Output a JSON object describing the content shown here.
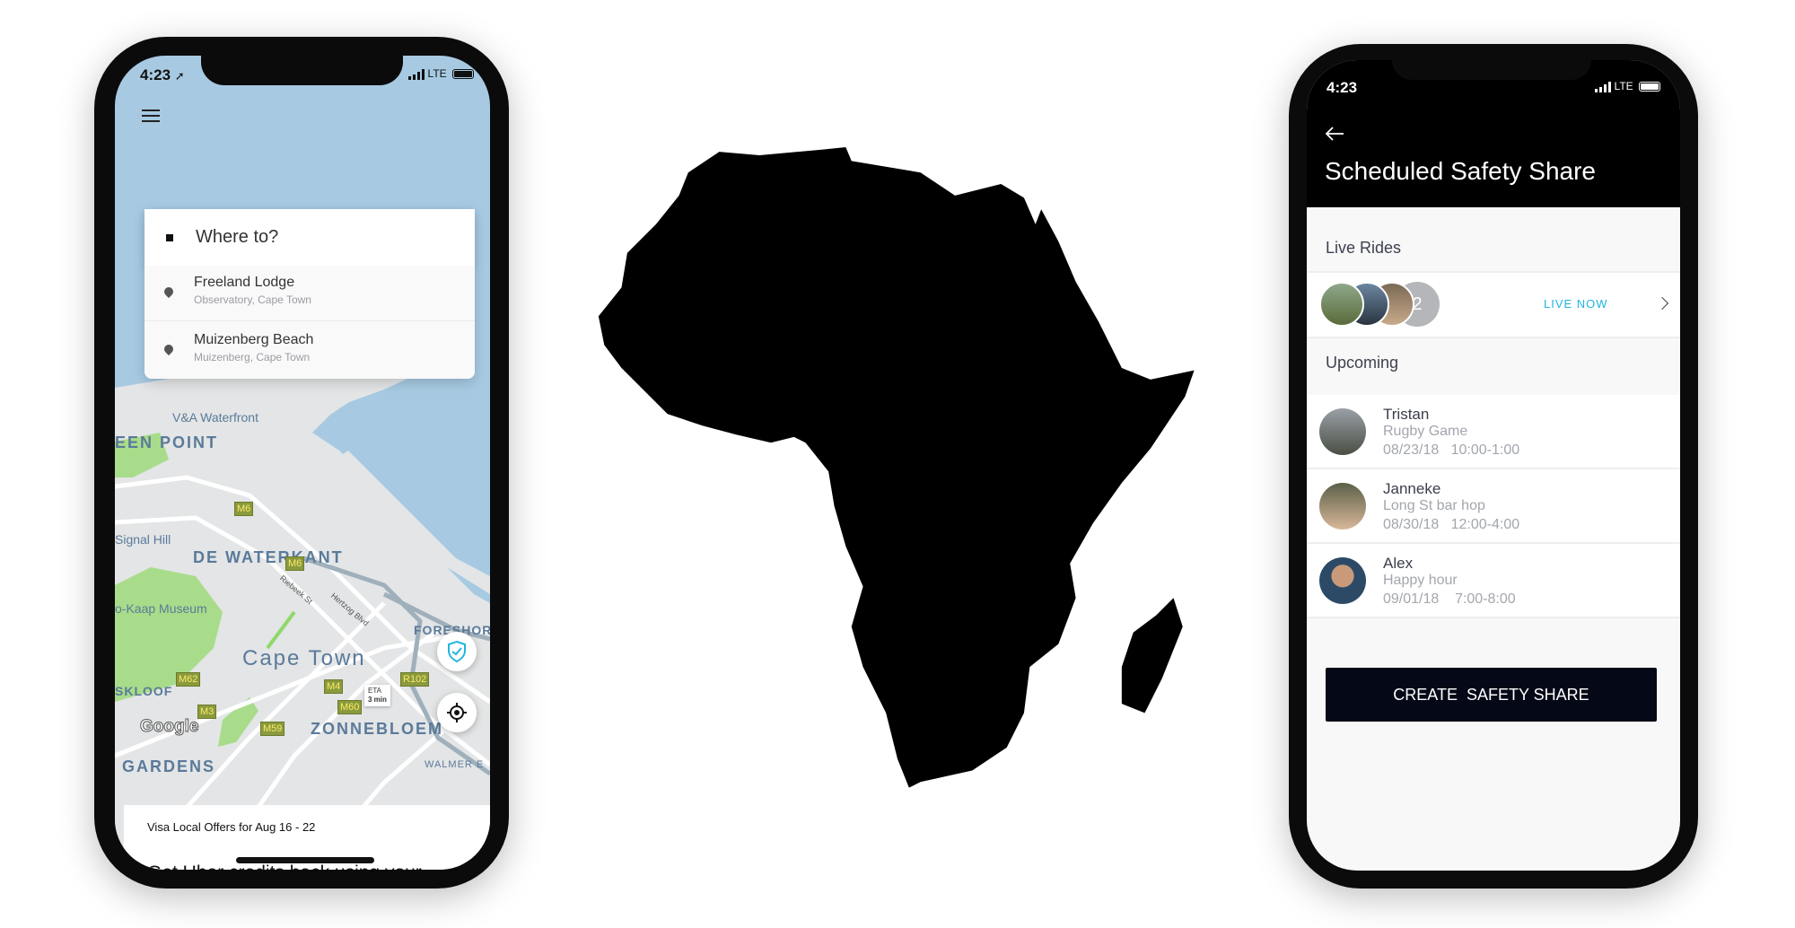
{
  "left_phone": {
    "status": {
      "time": "4:23",
      "network": "LTE"
    },
    "search": {
      "placeholder": "Where to?"
    },
    "suggestions": [
      {
        "title": "Freeland Lodge",
        "subtitle": "Observatory, Cape Town"
      },
      {
        "title": "Muizenberg Beach",
        "subtitle": "Muizenberg, Cape Town"
      }
    ],
    "map": {
      "labels": [
        "V&A Waterfront",
        "EEN POINT",
        "Signal Hill",
        "DE WATERKANT",
        "o-Kaap Museum",
        "FORESHORE",
        "Cape Town",
        "SKLOOF",
        "ZONNEBLOEM",
        "GARDENS",
        "WALMER E",
        "Riebeek St",
        "Hertzog Blvd"
      ],
      "road_badges": [
        "M6",
        "M6",
        "M62",
        "M3",
        "M59",
        "M4",
        "M60",
        "R102"
      ],
      "eta": {
        "label": "ETA",
        "value": "3 min"
      },
      "logo": "Google",
      "colors": {
        "water": "#a7cae2",
        "land": "#e3e5e6",
        "park": "#a8dc8a"
      }
    },
    "offer": {
      "title": "Visa Local Offers for Aug 16 - 22",
      "body": "Get Uber credits back using your Visa card around town"
    }
  },
  "right_phone": {
    "status": {
      "time": "4:23",
      "network": "LTE"
    },
    "title": "Scheduled Safety Share",
    "live_rides": {
      "label": "Live Rides",
      "extra_count": "2",
      "status": "LIVE NOW",
      "accent": "#1fb6de"
    },
    "upcoming": {
      "label": "Upcoming",
      "items": [
        {
          "name": "Tristan",
          "event": "Rugby Game",
          "when": "08/23/18   10:00-1:00"
        },
        {
          "name": "Janneke",
          "event": "Long St bar hop",
          "when": "08/30/18   12:00-4:00"
        },
        {
          "name": "Alex",
          "event": "Happy hour",
          "when": "09/01/18    7:00-8:00"
        }
      ]
    },
    "cta": "CREATE  SAFETY SHARE"
  }
}
